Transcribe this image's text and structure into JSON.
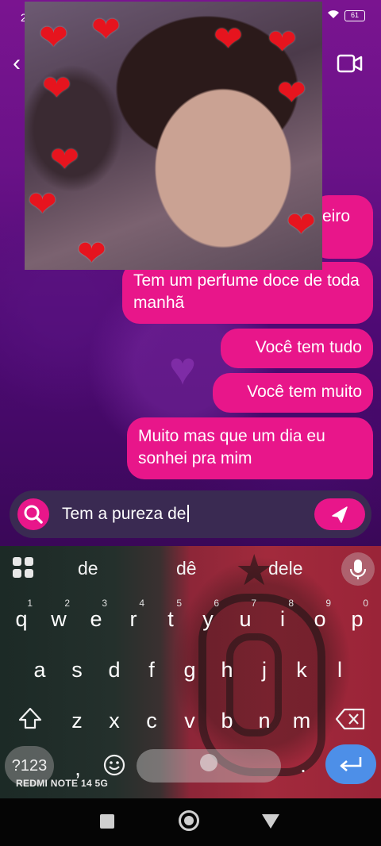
{
  "status_bar": {
    "time": "2",
    "battery": "61"
  },
  "messages": [
    {
      "text": "eiro"
    },
    {
      "text": "Tem um perfume doce de toda manhã"
    },
    {
      "text": "Você tem tudo"
    },
    {
      "text": "Você tem muito"
    },
    {
      "text": "Muito mas que um dia eu sonhei pra mim"
    }
  ],
  "composer": {
    "text": "Tem a pureza de"
  },
  "keyboard": {
    "suggestions": [
      "de",
      "dê",
      "dele"
    ],
    "row1": [
      {
        "key": "q",
        "hint": "1"
      },
      {
        "key": "w",
        "hint": "2"
      },
      {
        "key": "e",
        "hint": "3"
      },
      {
        "key": "r",
        "hint": "4"
      },
      {
        "key": "t",
        "hint": "5"
      },
      {
        "key": "y",
        "hint": "6"
      },
      {
        "key": "u",
        "hint": "7"
      },
      {
        "key": "i",
        "hint": "8"
      },
      {
        "key": "o",
        "hint": "9"
      },
      {
        "key": "p",
        "hint": "0"
      }
    ],
    "row2": [
      "a",
      "s",
      "d",
      "f",
      "g",
      "h",
      "j",
      "k",
      "l"
    ],
    "row3": [
      "z",
      "x",
      "c",
      "v",
      "b",
      "n",
      "m"
    ],
    "symbols_label": "?123",
    "comma": ",",
    "period": ".",
    "device_label": "REDMI NOTE 14 5G"
  },
  "icons": {
    "back": "back-arrow-icon",
    "video": "video-camera-icon",
    "search": "search-icon",
    "send": "send-icon",
    "apps": "grid-apps-icon",
    "mic": "microphone-icon",
    "shift": "shift-icon",
    "backspace": "backspace-icon",
    "emoji": "emoji-icon",
    "enter": "enter-icon"
  },
  "colors": {
    "accent": "#e8168a",
    "enter_key": "#4d8fe8"
  }
}
